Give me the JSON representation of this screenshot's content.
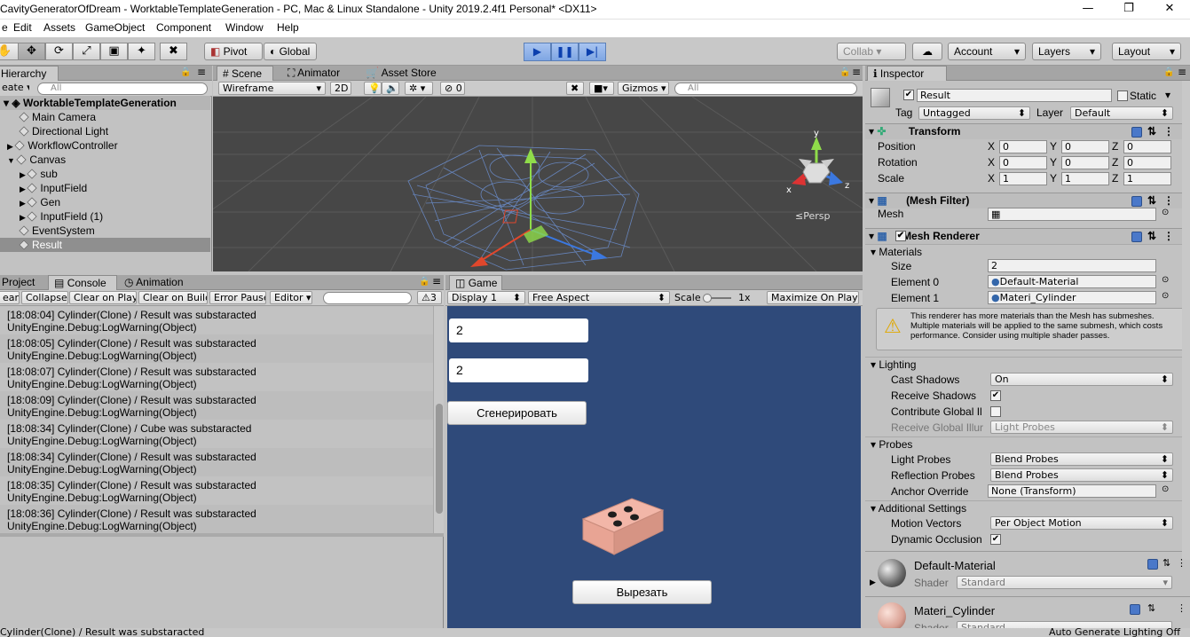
{
  "window": {
    "title": "CavityGeneratorOfDream - WorktableTemplateGeneration - PC, Mac & Linux Standalone - Unity 2019.2.4f1 Personal* <DX11>",
    "minimize": "—",
    "maximize": "❐",
    "close": "✕"
  },
  "menu": [
    "e",
    "Edit",
    "Assets",
    "GameObject",
    "Component",
    "Window",
    "Help"
  ],
  "toolbar": {
    "pivot": "Pivot",
    "global": "Global",
    "collab": "Collab ▾",
    "account": "Account",
    "layers": "Layers",
    "layout": "Layout"
  },
  "hierarchy": {
    "tab": "Hierarchy",
    "create": "eate ▾",
    "search_placeholder": "All",
    "scene": "WorktableTemplateGeneration",
    "items": [
      "Main Camera",
      "Directional Light",
      "WorkflowController",
      "Canvas",
      "sub",
      "InputField",
      "Gen",
      "InputField (1)",
      "EventSystem",
      "Result"
    ]
  },
  "scene": {
    "tabs": [
      "Scene",
      "Animator",
      "Asset Store"
    ],
    "shading": "Wireframe",
    "mode2d": "2D",
    "fx_count": "0",
    "gizmos": "Gizmos",
    "search_placeholder": "All",
    "persp": "≤Persp",
    "axis_x": "x",
    "axis_y": "y",
    "axis_z": "z"
  },
  "console": {
    "tabs": [
      "Project",
      "Console",
      "Animation"
    ],
    "buttons": [
      "ear",
      "Collapse",
      "Clear on Play",
      "Clear on Build",
      "Error Pause",
      "Editor ▾"
    ],
    "warning_count": "3",
    "entries": [
      {
        "line1": "[18:08:04] Cylinder(Clone) / Result was substaracted",
        "line2": "UnityEngine.Debug:LogWarning(Object)"
      },
      {
        "line1": "[18:08:05] Cylinder(Clone) / Result was substaracted",
        "line2": "UnityEngine.Debug:LogWarning(Object)"
      },
      {
        "line1": "[18:08:07] Cylinder(Clone) / Result was substaracted",
        "line2": "UnityEngine.Debug:LogWarning(Object)"
      },
      {
        "line1": "[18:08:09] Cylinder(Clone) / Result was substaracted",
        "line2": "UnityEngine.Debug:LogWarning(Object)"
      },
      {
        "line1": "[18:08:34] Cylinder(Clone) / Cube was substaracted",
        "line2": "UnityEngine.Debug:LogWarning(Object)"
      },
      {
        "line1": "[18:08:34] Cylinder(Clone) / Result was substaracted",
        "line2": "UnityEngine.Debug:LogWarning(Object)"
      },
      {
        "line1": "[18:08:35] Cylinder(Clone) / Result was substaracted",
        "line2": "UnityEngine.Debug:LogWarning(Object)"
      },
      {
        "line1": "[18:08:36] Cylinder(Clone) / Result was substaracted",
        "line2": "UnityEngine.Debug:LogWarning(Object)"
      }
    ]
  },
  "game": {
    "tab": "Game",
    "display": "Display 1",
    "aspect": "Free Aspect",
    "scale_label": "Scale",
    "scale_value": "1x",
    "maximize": "Maximize On Play",
    "input1": "2",
    "input2": "2",
    "generate": "Сгенерировать",
    "cut": "Вырезать",
    "background": "#2f4a7a"
  },
  "inspector": {
    "tab": "Inspector",
    "name": "Result",
    "static": "Static",
    "tag_label": "Tag",
    "tag": "Untagged",
    "layer_label": "Layer",
    "layer": "Default",
    "transform": {
      "title": "Transform",
      "rows": [
        {
          "label": "Position",
          "x": "0",
          "y": "0",
          "z": "0"
        },
        {
          "label": "Rotation",
          "x": "0",
          "y": "0",
          "z": "0"
        },
        {
          "label": "Scale",
          "x": "1",
          "y": "1",
          "z": "1"
        }
      ]
    },
    "mesh_filter": {
      "title": "(Mesh Filter)",
      "mesh_label": "Mesh"
    },
    "mesh_renderer": {
      "title": "Mesh Renderer",
      "materials": "Materials",
      "size_label": "Size",
      "size": "2",
      "el0_label": "Element 0",
      "el0": "Default-Material",
      "el1_label": "Element 1",
      "el1": "Materi_Cylinder",
      "warning": "This renderer has more materials than the Mesh has submeshes. Multiple materials will be applied to the same submesh, which costs performance. Consider using multiple shader passes.",
      "lighting": "Lighting",
      "cast_shadows_label": "Cast Shadows",
      "cast_shadows": "On",
      "receive_shadows_label": "Receive Shadows",
      "contribute_gi_label": "Contribute Global Il",
      "receive_gi_label": "Receive Global Illur",
      "receive_gi": "Light Probes",
      "probes": "Probes",
      "light_probes_label": "Light Probes",
      "light_probes": "Blend Probes",
      "reflection_probes_label": "Reflection Probes",
      "reflection_probes": "Blend Probes",
      "anchor_label": "Anchor Override",
      "anchor": "None (Transform)",
      "additional": "Additional Settings",
      "motion_label": "Motion Vectors",
      "motion": "Per Object Motion",
      "dynamic_label": "Dynamic Occlusion"
    },
    "materials_list": [
      {
        "name": "Default-Material",
        "shader_label": "Shader",
        "shader": "Standard"
      },
      {
        "name": "Materi_Cylinder",
        "shader_label": "Shader",
        "shader": "Standard"
      }
    ]
  },
  "status": {
    "message": "Cylinder(Clone) / Result was substaracted",
    "right": "Auto Generate Lighting Off"
  }
}
